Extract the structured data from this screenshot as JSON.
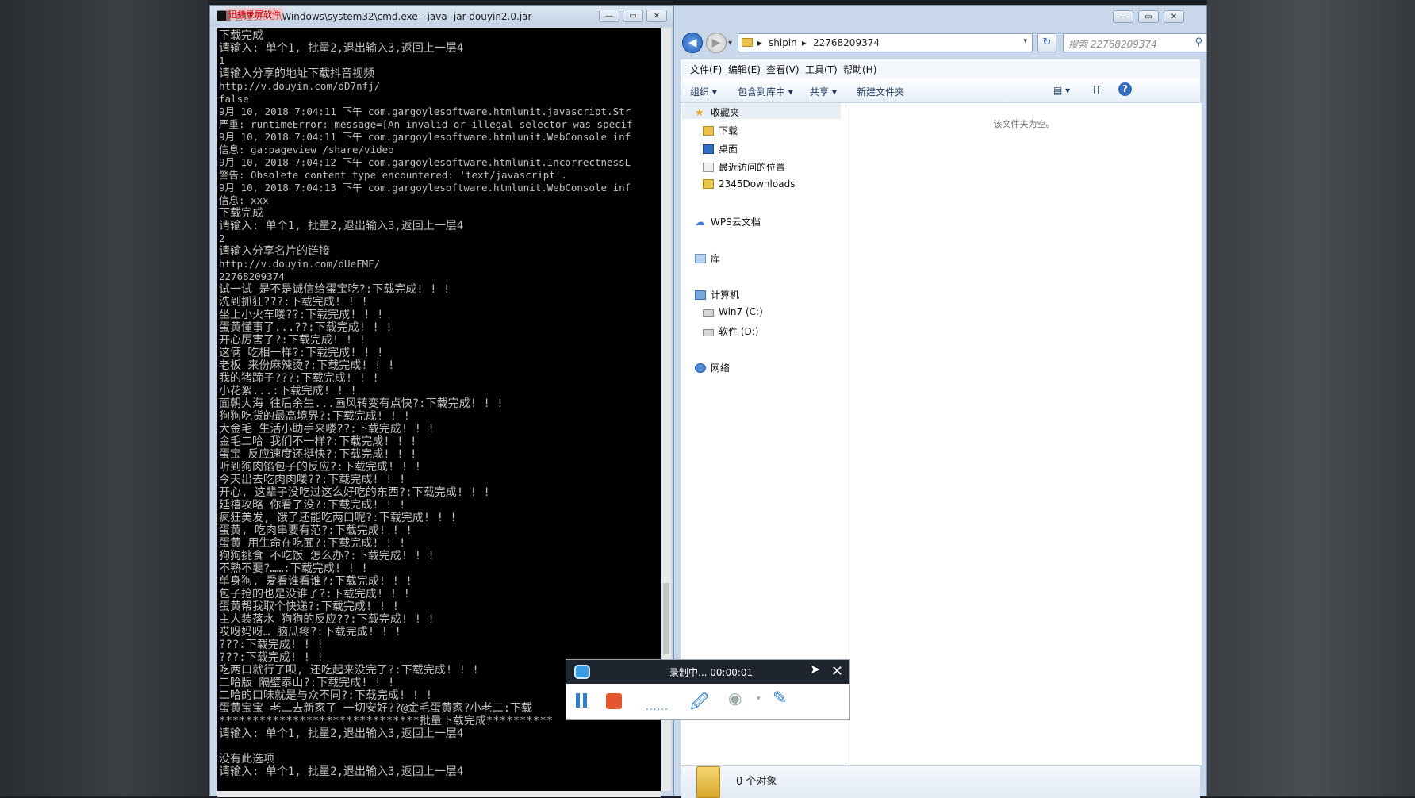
{
  "cmd": {
    "title": "管理员: C:\\Windows\\system32\\cmd.exe - java  -jar douyin2.0.jar",
    "watermark": "迅捷录屏软件",
    "lines": [
      {
        "t": "下载完成",
        "s": 0
      },
      {
        "t": "请输入: 单个1, 批量2,退出输入3,返回上一层4",
        "s": 0
      },
      {
        "t": "1",
        "s": 1
      },
      {
        "t": "请输入分享的地址下载抖音视频",
        "s": 0
      },
      {
        "t": "http://v.douyin.com/dD7nfj/",
        "s": 1
      },
      {
        "t": "false",
        "s": 1
      },
      {
        "t": "9月 10, 2018 7:04:11 下午 com.gargoylesoftware.htmlunit.javascript.Str",
        "s": 1
      },
      {
        "t": "严重: runtimeError: message=[An invalid or illegal selector was specif",
        "s": 1
      },
      {
        "t": "9月 10, 2018 7:04:11 下午 com.gargoylesoftware.htmlunit.WebConsole inf",
        "s": 1
      },
      {
        "t": "信息: ga:pageview /share/video",
        "s": 1
      },
      {
        "t": "9月 10, 2018 7:04:12 下午 com.gargoylesoftware.htmlunit.IncorrectnessL",
        "s": 1
      },
      {
        "t": "警告: Obsolete content type encountered: 'text/javascript'.",
        "s": 1
      },
      {
        "t": "9月 10, 2018 7:04:13 下午 com.gargoylesoftware.htmlunit.WebConsole inf",
        "s": 1
      },
      {
        "t": "信息: xxx",
        "s": 1
      },
      {
        "t": "下载完成",
        "s": 0
      },
      {
        "t": "请输入: 单个1, 批量2,退出输入3,返回上一层4",
        "s": 0
      },
      {
        "t": "2",
        "s": 1
      },
      {
        "t": "请输入分享名片的链接",
        "s": 0
      },
      {
        "t": "http://v.douyin.com/dUeFMF/",
        "s": 1
      },
      {
        "t": "22768209374",
        "s": 1
      },
      {
        "t": "试一试 是不是诚信给蛋宝吃?:下载完成! ! !",
        "s": 0
      },
      {
        "t": "洗到抓狂???:下载完成! ! !",
        "s": 0
      },
      {
        "t": "坐上小火车喽??:下载完成! ! !",
        "s": 0
      },
      {
        "t": "蛋黄懂事了...??:下载完成! ! !",
        "s": 0
      },
      {
        "t": "开心厉害了?:下载完成! ! !",
        "s": 0
      },
      {
        "t": "这俩 吃相一样?:下载完成! ! !",
        "s": 0
      },
      {
        "t": "老板 来份麻辣烫?:下载完成! ! !",
        "s": 0
      },
      {
        "t": "我的猪蹄子???:下载完成! ! !",
        "s": 0
      },
      {
        "t": "小花絮...:下载完成! ! !",
        "s": 0
      },
      {
        "t": "面朝大海 往后余生...画风转变有点快?:下载完成! ! !",
        "s": 0
      },
      {
        "t": "狗狗吃货的最高境界?:下载完成! ! !",
        "s": 0
      },
      {
        "t": "大金毛 生活小助手来喽??:下载完成! ! !",
        "s": 0
      },
      {
        "t": "金毛二哈 我们不一样?:下载完成! ! !",
        "s": 0
      },
      {
        "t": "蛋宝 反应速度还挺快?:下载完成! ! !",
        "s": 0
      },
      {
        "t": "听到狗肉馅包子的反应?:下载完成! ! !",
        "s": 0
      },
      {
        "t": "今天出去吃肉肉喽??:下载完成! ! !",
        "s": 0
      },
      {
        "t": "开心, 这辈子没吃过这么好吃的东西?:下载完成! ! !",
        "s": 0
      },
      {
        "t": "延禧攻略 你看了没?:下载完成! ! !",
        "s": 0
      },
      {
        "t": "疯狂美发, 饿了还能吃两口呢?:下载完成! ! !",
        "s": 0
      },
      {
        "t": "蛋黄, 吃肉串要有范?:下载完成! ! !",
        "s": 0
      },
      {
        "t": "蛋黄 用生命在吃面?:下载完成! ! !",
        "s": 0
      },
      {
        "t": "狗狗挑食 不吃饭 怎么办?:下载完成! ! !",
        "s": 0
      },
      {
        "t": "不熟不要?……:下载完成! ! !",
        "s": 0
      },
      {
        "t": "单身狗, 爱看谁看谁?:下载完成! ! !",
        "s": 0
      },
      {
        "t": "包子抢的也是没谁了?:下载完成! ! !",
        "s": 0
      },
      {
        "t": "蛋黄帮我取个快递?:下载完成! ! !",
        "s": 0
      },
      {
        "t": "主人装落水 狗狗的反应??:下载完成! ! !",
        "s": 0
      },
      {
        "t": "哎呀妈呀… 脑瓜疼?:下载完成! ! !",
        "s": 0
      },
      {
        "t": "???:下载完成! ! !",
        "s": 0
      },
      {
        "t": "???:下载完成! ! !",
        "s": 0
      },
      {
        "t": "吃两口就行了呗, 还吃起来没完了?:下载完成! ! !",
        "s": 0
      },
      {
        "t": "二哈版 隔壁泰山?:下载完成! ! !",
        "s": 0
      },
      {
        "t": "二哈的口味就是与众不同?:下载完成! ! !",
        "s": 0
      },
      {
        "t": "蛋黄宝宝 老二去新家了 一切安好??@金毛蛋黄家?小老二:下载",
        "s": 0
      },
      {
        "t": "******************************批量下载完成**********",
        "s": 0
      },
      {
        "t": "请输入: 单个1, 批量2,退出输入3,返回上一层4",
        "s": 0
      },
      {
        "t": "",
        "s": 0
      },
      {
        "t": "没有此选项",
        "s": 0
      },
      {
        "t": "请输入: 单个1, 批量2,退出输入3,返回上一层4",
        "s": 0
      }
    ],
    "window_buttons": {
      "minimize": "—",
      "maximize": "▭",
      "close": "✕"
    }
  },
  "explorer": {
    "window_buttons": {
      "minimize": "—",
      "maximize": "▭",
      "close": "✕"
    },
    "nav": {
      "back": "◀",
      "forward": "▶",
      "recent": "▾",
      "refresh": "↻"
    },
    "address": {
      "separator": "▸",
      "segments": [
        "shipin",
        "22768209374"
      ],
      "dropdown": "▾"
    },
    "search": {
      "placeholder": "搜索 22768209374",
      "icon": "⚲"
    },
    "menu": [
      "文件(F)",
      "编辑(E)",
      "查看(V)",
      "工具(T)",
      "帮助(H)"
    ],
    "toolbar": {
      "organize": "组织 ▾",
      "include": "包含到库中 ▾",
      "share": "共享 ▾",
      "new_folder": "新建文件夹",
      "view": "▤ ▾",
      "pane": "◫",
      "help": "?"
    },
    "sidebar": {
      "favorites": "收藏夹",
      "downloads": "下载",
      "desktop": "桌面",
      "recent": "最近访问的位置",
      "downloads2345": "2345Downloads",
      "wps": "WPS云文档",
      "library": "库",
      "computer": "计算机",
      "drive_c": "Win7 (C:)",
      "drive_d": "软件 (D:)",
      "network": "网络"
    },
    "empty_message": "该文件夹为空。",
    "object_count": "0 个对象"
  },
  "recorder": {
    "status": "录制中... 00:00:01",
    "close": "✕",
    "cursor": "➤",
    "tools": {
      "dots": "......",
      "pen": "🖉",
      "webcam": "◉",
      "dd": "▾",
      "draw": "✎"
    }
  }
}
